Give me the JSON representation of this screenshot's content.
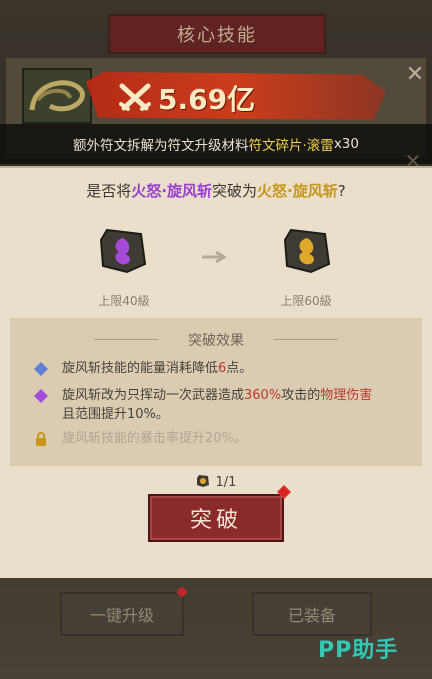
{
  "screen": {
    "title": "核心技能",
    "power_value": "5.69亿",
    "bottom_buttons": {
      "upgrade_all": "一键升级",
      "equipped": "已装备"
    },
    "watermark": "PP助手"
  },
  "info_strip": {
    "prefix": "额外符文拆解为符文升级材料",
    "highlight": "符文碎片·滚雷",
    "suffix": "x30"
  },
  "dialog": {
    "question": {
      "prefix": "是否将",
      "from": "火怒·旋风斩",
      "middle": "突破为",
      "to": "火怒·旋风斩",
      "suffix": "?"
    },
    "from_cap": "上限40級",
    "to_cap": "上限60級",
    "effects_title": "突破效果",
    "effects": [
      {
        "pre": "旋风斩技能的能量消耗降低",
        "num": "6",
        "post": "点。"
      },
      {
        "pre": "旋风斩改为只挥动一次武器造成",
        "num": "360%",
        "mid": "攻击的",
        "phys": "物理伤害",
        "line2": "且范围提升10%。"
      },
      {
        "text": "旋风斩技能的暴击率提升20%。",
        "locked": true
      }
    ],
    "count": "1/1",
    "confirm_label": "突破"
  },
  "colors": {
    "accent_red": "#8b2a2c",
    "purple": "#9b3fd0",
    "gold": "#c8961b",
    "damage_red": "#c0392b"
  }
}
